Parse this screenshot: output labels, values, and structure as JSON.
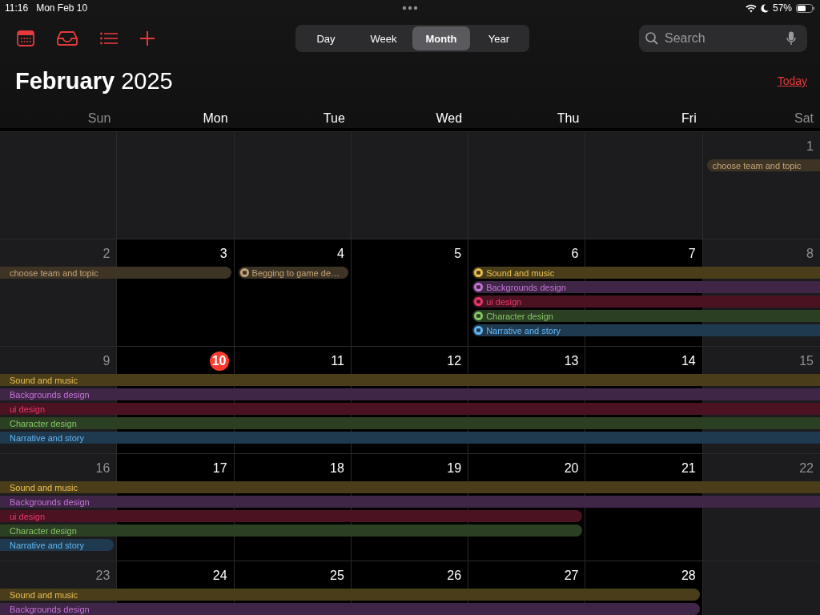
{
  "status_bar": {
    "time": "11:16",
    "date": "Mon Feb 10",
    "battery": "57%"
  },
  "toolbar": {
    "views": [
      {
        "label": "Day",
        "selected": false
      },
      {
        "label": "Week",
        "selected": false
      },
      {
        "label": "Month",
        "selected": true
      },
      {
        "label": "Year",
        "selected": false
      }
    ],
    "search": {
      "placeholder": "Search"
    }
  },
  "title": "**February** 2025",
  "today_button": "Today",
  "weekdays": [
    "Sun",
    "Mon",
    "Tue",
    "Wed",
    "Thu",
    "Fri",
    "Sat"
  ],
  "weeks": [
    {
      "days": [
        {
          "kind": "blank"
        },
        {
          "kind": "blank"
        },
        {
          "kind": "blank"
        },
        {
          "kind": "blank"
        },
        {
          "kind": "blank"
        },
        {
          "kind": "blank"
        },
        {
          "kind": "date",
          "number": "1",
          "today": false
        }
      ],
      "lanes": [
        [
          {
            "kind": "free"
          },
          {
            "kind": "free"
          },
          {
            "kind": "free"
          },
          {
            "kind": "free"
          },
          {
            "kind": "free"
          },
          {
            "kind": "free"
          },
          {
            "kind": "event",
            "title": "choose team and topic",
            "color": "#3e3426",
            "icon": false
          }
        ]
      ]
    },
    {
      "days": [
        {
          "kind": "date",
          "number": "2",
          "today": false
        },
        {
          "kind": "date",
          "number": "3",
          "today": false
        },
        {
          "kind": "date",
          "number": "4",
          "today": false
        },
        {
          "kind": "date",
          "number": "5",
          "today": false
        },
        {
          "kind": "date",
          "number": "6",
          "today": false
        },
        {
          "kind": "date",
          "number": "7",
          "today": false
        },
        {
          "kind": "date",
          "number": "8",
          "today": false
        }
      ],
      "lanes": [
        [
          {
            "kind": "event",
            "title": "choose team and topic",
            "color": "#3e3426",
            "icon": false
          },
          {
            "kind": "more"
          },
          {
            "kind": "event",
            "title": "Begging to game de…",
            "color": "#3e3426",
            "icon": true
          },
          {
            "kind": "free"
          },
          {
            "kind": "event",
            "title": "Sound and music",
            "color": "#4a3d1a",
            "icon": true
          },
          {
            "kind": "more"
          },
          {
            "kind": "more"
          }
        ],
        [
          {
            "kind": "free"
          },
          {
            "kind": "free"
          },
          {
            "kind": "free"
          },
          {
            "kind": "free"
          },
          {
            "kind": "event",
            "title": "Backgrounds design",
            "color": "#3f2546",
            "icon": true
          },
          {
            "kind": "more"
          },
          {
            "kind": "more"
          }
        ],
        [
          {
            "kind": "free"
          },
          {
            "kind": "free"
          },
          {
            "kind": "free"
          },
          {
            "kind": "free"
          },
          {
            "kind": "event",
            "title": "ui design",
            "color": "#4b1222",
            "icon": true
          },
          {
            "kind": "more"
          },
          {
            "kind": "more"
          }
        ],
        [
          {
            "kind": "free"
          },
          {
            "kind": "free"
          },
          {
            "kind": "free"
          },
          {
            "kind": "free"
          },
          {
            "kind": "event",
            "title": "Character design",
            "color": "#2b3f22",
            "icon": true
          },
          {
            "kind": "more"
          },
          {
            "kind": "more"
          }
        ],
        [
          {
            "kind": "free"
          },
          {
            "kind": "free"
          },
          {
            "kind": "free"
          },
          {
            "kind": "free"
          },
          {
            "kind": "event",
            "title": "Narrative and story",
            "color": "#1f3a4f",
            "icon": true
          },
          {
            "kind": "more"
          },
          {
            "kind": "more"
          }
        ]
      ]
    },
    {
      "days": [
        {
          "kind": "date",
          "number": "9",
          "today": false
        },
        {
          "kind": "date",
          "number": "10",
          "today": true
        },
        {
          "kind": "date",
          "number": "11",
          "today": false
        },
        {
          "kind": "date",
          "number": "12",
          "today": false
        },
        {
          "kind": "date",
          "number": "13",
          "today": false
        },
        {
          "kind": "date",
          "number": "14",
          "today": false
        },
        {
          "kind": "date",
          "number": "15",
          "today": false
        }
      ],
      "lanes": [
        [
          {
            "kind": "event",
            "title": "Sound and music",
            "color": "#4a3d1a",
            "icon": false
          },
          {
            "kind": "more"
          },
          {
            "kind": "more"
          },
          {
            "kind": "more"
          },
          {
            "kind": "more"
          },
          {
            "kind": "more"
          },
          {
            "kind": "more"
          }
        ],
        [
          {
            "kind": "event",
            "title": "Backgrounds design",
            "color": "#3f2546",
            "icon": false
          },
          {
            "kind": "more"
          },
          {
            "kind": "more"
          },
          {
            "kind": "more"
          },
          {
            "kind": "more"
          },
          {
            "kind": "more"
          },
          {
            "kind": "more"
          }
        ],
        [
          {
            "kind": "event",
            "title": "ui design",
            "color": "#4b1222",
            "icon": false
          },
          {
            "kind": "more"
          },
          {
            "kind": "more"
          },
          {
            "kind": "more"
          },
          {
            "kind": "more"
          },
          {
            "kind": "more"
          },
          {
            "kind": "more"
          }
        ],
        [
          {
            "kind": "event",
            "title": "Character design",
            "color": "#2b3f22",
            "icon": false
          },
          {
            "kind": "more"
          },
          {
            "kind": "more"
          },
          {
            "kind": "more"
          },
          {
            "kind": "more"
          },
          {
            "kind": "more"
          },
          {
            "kind": "more"
          }
        ],
        [
          {
            "kind": "event",
            "title": "Narrative and story",
            "color": "#1f3a4f",
            "icon": false
          },
          {
            "kind": "more"
          },
          {
            "kind": "more"
          },
          {
            "kind": "more"
          },
          {
            "kind": "more"
          },
          {
            "kind": "more"
          },
          {
            "kind": "more"
          }
        ]
      ]
    },
    {
      "days": [
        {
          "kind": "date",
          "number": "16",
          "today": false
        },
        {
          "kind": "date",
          "number": "17",
          "today": false
        },
        {
          "kind": "date",
          "number": "18",
          "today": false
        },
        {
          "kind": "date",
          "number": "19",
          "today": false
        },
        {
          "kind": "date",
          "number": "20",
          "today": false
        },
        {
          "kind": "date",
          "number": "21",
          "today": false
        },
        {
          "kind": "date",
          "number": "22",
          "today": false
        }
      ],
      "lanes": [
        [
          {
            "kind": "event",
            "title": "Sound and music",
            "color": "#4a3d1a",
            "icon": false
          },
          {
            "kind": "more"
          },
          {
            "kind": "more"
          },
          {
            "kind": "more"
          },
          {
            "kind": "more"
          },
          {
            "kind": "more"
          },
          {
            "kind": "more"
          }
        ],
        [
          {
            "kind": "event",
            "title": "Backgrounds design",
            "color": "#3f2546",
            "icon": false
          },
          {
            "kind": "more"
          },
          {
            "kind": "more"
          },
          {
            "kind": "more"
          },
          {
            "kind": "more"
          },
          {
            "kind": "more"
          },
          {
            "kind": "more"
          }
        ],
        [
          {
            "kind": "event",
            "title": "ui design",
            "color": "#4b1222",
            "icon": false
          },
          {
            "kind": "more"
          },
          {
            "kind": "more"
          },
          {
            "kind": "more"
          },
          {
            "kind": "more"
          },
          {
            "kind": "free"
          },
          {
            "kind": "free"
          }
        ],
        [
          {
            "kind": "event",
            "title": "Character design",
            "color": "#2b3f22",
            "icon": false
          },
          {
            "kind": "more"
          },
          {
            "kind": "more"
          },
          {
            "kind": "more"
          },
          {
            "kind": "more"
          },
          {
            "kind": "free"
          },
          {
            "kind": "free"
          }
        ],
        [
          {
            "kind": "event",
            "title": "Narrative and story",
            "color": "#1f3a4f",
            "icon": false
          },
          {
            "kind": "free"
          },
          {
            "kind": "free"
          },
          {
            "kind": "free"
          },
          {
            "kind": "free"
          },
          {
            "kind": "free"
          },
          {
            "kind": "free"
          }
        ]
      ]
    },
    {
      "days": [
        {
          "kind": "date",
          "number": "23",
          "today": false
        },
        {
          "kind": "date",
          "number": "24",
          "today": false
        },
        {
          "kind": "date",
          "number": "25",
          "today": false
        },
        {
          "kind": "date",
          "number": "26",
          "today": false
        },
        {
          "kind": "date",
          "number": "27",
          "today": false
        },
        {
          "kind": "date",
          "number": "28",
          "today": false
        },
        {
          "kind": "blank"
        }
      ],
      "lanes": [
        [
          {
            "kind": "event",
            "title": "Sound and music",
            "color": "#4a3d1a",
            "icon": false
          },
          {
            "kind": "more"
          },
          {
            "kind": "more"
          },
          {
            "kind": "more"
          },
          {
            "kind": "more"
          },
          {
            "kind": "more"
          },
          {
            "kind": "free"
          }
        ],
        [
          {
            "kind": "event",
            "title": "Backgrounds design",
            "color": "#3f2546",
            "icon": false
          },
          {
            "kind": "more"
          },
          {
            "kind": "more"
          },
          {
            "kind": "more"
          },
          {
            "kind": "more"
          },
          {
            "kind": "more"
          },
          {
            "kind": "free"
          }
        ]
      ]
    }
  ]
}
